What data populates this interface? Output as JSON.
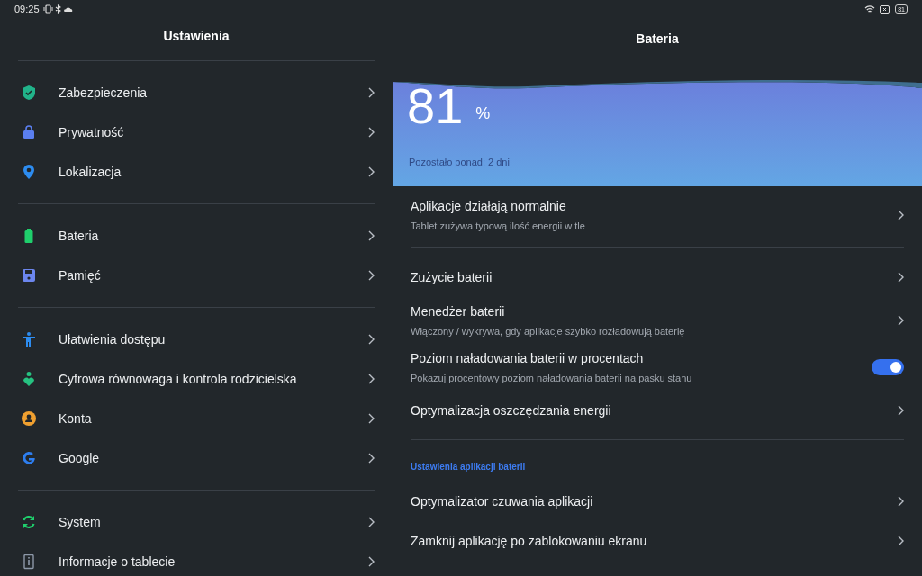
{
  "status_bar": {
    "time": "09:25",
    "battery": "81"
  },
  "sidebar": {
    "title": "Ustawienia",
    "groups": [
      [
        {
          "label": "Zabezpieczenia"
        },
        {
          "label": "Prywatność"
        },
        {
          "label": "Lokalizacja"
        }
      ],
      [
        {
          "label": "Bateria"
        },
        {
          "label": "Pamięć"
        }
      ],
      [
        {
          "label": "Ułatwienia dostępu"
        },
        {
          "label": "Cyfrowa równowaga i kontrola rodzicielska"
        },
        {
          "label": "Konta"
        },
        {
          "label": "Google"
        }
      ],
      [
        {
          "label": "System"
        },
        {
          "label": "Informacje o tablecie"
        }
      ]
    ]
  },
  "page": {
    "title": "Bateria",
    "battery_percent": "81",
    "percent_sign": "%",
    "remaining": "Pozostało ponad: 2 dni",
    "rows": [
      {
        "kind": "nav",
        "title": "Aplikacje działają normalnie",
        "subtitle": "Tablet zużywa typową ilość energii w tle"
      },
      {
        "kind": "divider"
      },
      {
        "kind": "nav",
        "title": "Zużycie baterii"
      },
      {
        "kind": "nav",
        "title": "Menedżer baterii",
        "subtitle": "Włączony / wykrywa, gdy aplikacje szybko rozładowują baterię"
      },
      {
        "kind": "toggle",
        "title": "Poziom naładowania baterii w procentach",
        "subtitle": "Pokazuj procentowy poziom naładowania baterii na pasku stanu",
        "on": true
      },
      {
        "kind": "nav",
        "title": "Optymalizacja oszczędzania energii"
      },
      {
        "kind": "divider"
      },
      {
        "kind": "header",
        "title": "Ustawienia aplikacji baterii"
      },
      {
        "kind": "nav",
        "title": "Optymalizator czuwania aplikacji"
      },
      {
        "kind": "nav",
        "title": "Zamknij aplikację po zablokowaniu ekranu"
      }
    ]
  }
}
